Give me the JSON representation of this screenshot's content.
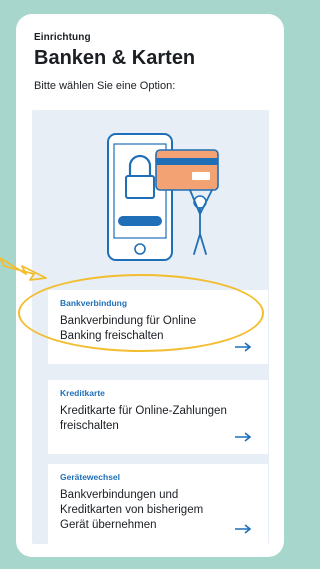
{
  "header": {
    "overline": "Einrichtung",
    "title": "Banken & Karten",
    "subtitle": "Bitte wählen Sie eine Option:"
  },
  "options": [
    {
      "label": "Bankverbindung",
      "text": "Bankverbindung für Online Banking freischalten"
    },
    {
      "label": "Kreditkarte",
      "text": "Kreditkarte für Online-Zahlungen freischalten"
    },
    {
      "label": "Gerätewechsel",
      "text": "Bankverbindungen und Kreditkarten von bisherigem Gerät übernehmen"
    }
  ],
  "colors": {
    "background": "#a7d6cc",
    "accent": "#1f6fb8",
    "highlight": "#f2bd2f",
    "card_orange": "#f3a373"
  },
  "icons": [
    "phone-lock-card-illustration",
    "arrow-right-icon",
    "pointer-arrow-icon"
  ]
}
